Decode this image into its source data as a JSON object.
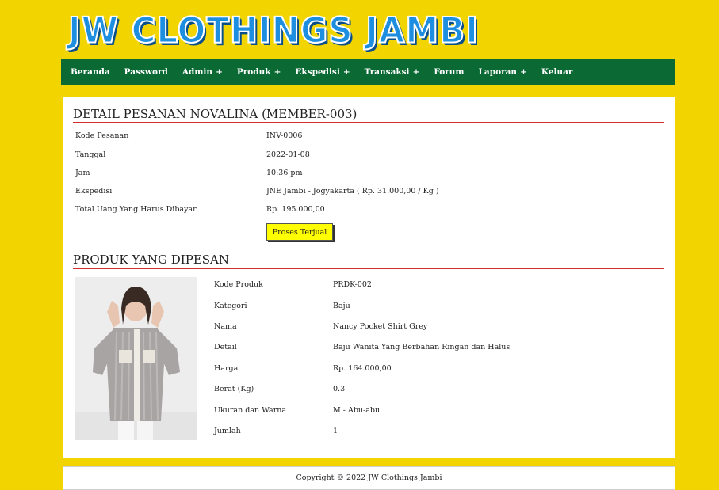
{
  "site": {
    "logo_text": "JW CLOTHINGS JAMBI"
  },
  "nav": {
    "items": [
      {
        "label": "Beranda",
        "plus": ""
      },
      {
        "label": "Password",
        "plus": ""
      },
      {
        "label": "Admin",
        "plus": "+"
      },
      {
        "label": "Produk",
        "plus": "+"
      },
      {
        "label": "Ekspedisi",
        "plus": "+"
      },
      {
        "label": "Transaksi",
        "plus": "+"
      },
      {
        "label": "Forum",
        "plus": ""
      },
      {
        "label": "Laporan",
        "plus": "+"
      },
      {
        "label": "Keluar",
        "plus": ""
      }
    ]
  },
  "order": {
    "title": "DETAIL PESANAN NOVALINA (MEMBER-003)",
    "rows": [
      {
        "label": "Kode Pesanan",
        "value": "INV-0006"
      },
      {
        "label": "Tanggal",
        "value": "2022-01-08"
      },
      {
        "label": "Jam",
        "value": "10:36 pm"
      },
      {
        "label": "Ekspedisi",
        "value": "JNE Jambi - Jogyakarta ( Rp. 31.000,00 / Kg )"
      },
      {
        "label": "Total Uang Yang Harus Dibayar",
        "value": "Rp. 195.000,00"
      }
    ],
    "button_label": "Proses Terjual"
  },
  "products": {
    "title": "PRODUK YANG DIPESAN",
    "rows": [
      {
        "label": "Kode Produk",
        "value": "PRDK-002"
      },
      {
        "label": "Kategori",
        "value": "Baju"
      },
      {
        "label": "Nama",
        "value": "Nancy Pocket Shirt Grey"
      },
      {
        "label": "Detail",
        "value": "Baju Wanita Yang Berbahan Ringan dan Halus"
      },
      {
        "label": "Harga",
        "value": "Rp. 164.000,00"
      },
      {
        "label": "Berat (Kg)",
        "value": "0.3"
      },
      {
        "label": "Ukuran dan Warna",
        "value": "M - Abu-abu"
      },
      {
        "label": "Jumlah",
        "value": "1"
      }
    ]
  },
  "footer": {
    "text": "Copyright © 2022 JW Clothings Jambi"
  }
}
